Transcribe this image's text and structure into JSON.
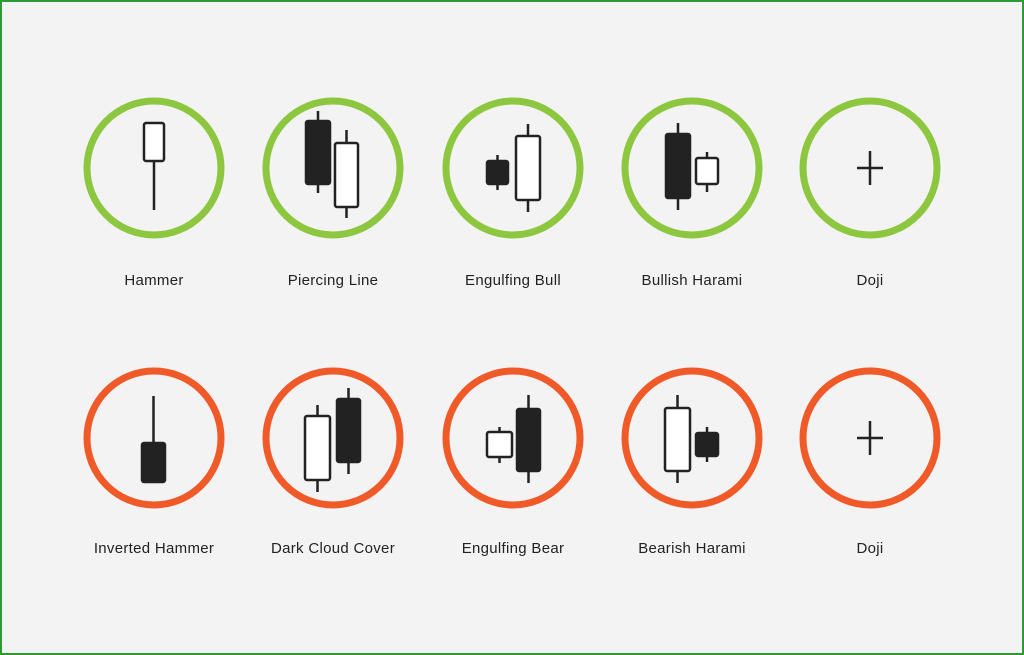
{
  "colors": {
    "bullish": "#8dc63f",
    "bearish": "#f05a28",
    "candle": "#222222",
    "frame": "#2e9a34"
  },
  "patterns": [
    {
      "label": "Hammer",
      "signal": "bullish"
    },
    {
      "label": "Piercing Line",
      "signal": "bullish"
    },
    {
      "label": "Engulfing Bull",
      "signal": "bullish"
    },
    {
      "label": "Bullish Harami",
      "signal": "bullish"
    },
    {
      "label": "Doji",
      "signal": "bullish"
    },
    {
      "label": "Inverted Hammer",
      "signal": "bearish"
    },
    {
      "label": "Dark Cloud Cover",
      "signal": "bearish"
    },
    {
      "label": "Engulfing Bear",
      "signal": "bearish"
    },
    {
      "label": "Bearish Harami",
      "signal": "bearish"
    },
    {
      "label": "Doji",
      "signal": "bearish"
    }
  ]
}
